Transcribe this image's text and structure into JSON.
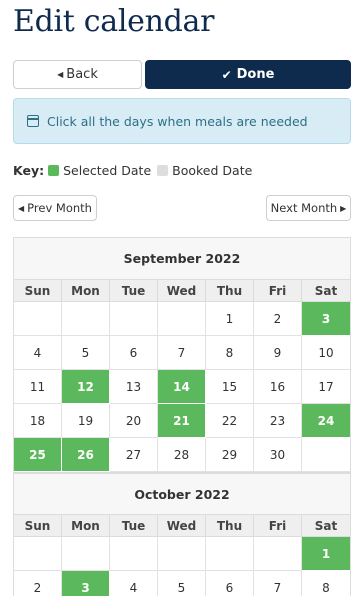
{
  "page": {
    "title": "Edit calendar"
  },
  "toolbar": {
    "back_label": "Back",
    "done_label": "Done"
  },
  "alert": {
    "message": "Click all the days when meals are needed"
  },
  "legend": {
    "key_label": "Key:",
    "selected_label": "Selected Date",
    "booked_label": "Booked Date",
    "selected_color": "#5cb85c",
    "booked_color": "#dddddd"
  },
  "nav": {
    "prev_label": "Prev Month",
    "next_label": "Next Month"
  },
  "weekdays": [
    "Sun",
    "Mon",
    "Tue",
    "Wed",
    "Thu",
    "Fri",
    "Sat"
  ],
  "months": [
    {
      "title": "September 2022",
      "weeks": [
        [
          "",
          "",
          "",
          "",
          "1",
          "2",
          "3"
        ],
        [
          "4",
          "5",
          "6",
          "7",
          "8",
          "9",
          "10"
        ],
        [
          "11",
          "12",
          "13",
          "14",
          "15",
          "16",
          "17"
        ],
        [
          "18",
          "19",
          "20",
          "21",
          "22",
          "23",
          "24"
        ],
        [
          "25",
          "26",
          "27",
          "28",
          "29",
          "30",
          ""
        ]
      ],
      "selected": [
        "3",
        "12",
        "14",
        "21",
        "24",
        "25",
        "26"
      ]
    },
    {
      "title": "October 2022",
      "weeks": [
        [
          "",
          "",
          "",
          "",
          "",
          "",
          "1"
        ],
        [
          "2",
          "3",
          "4",
          "5",
          "6",
          "7",
          "8"
        ]
      ],
      "selected": [
        "1",
        "3"
      ]
    }
  ]
}
